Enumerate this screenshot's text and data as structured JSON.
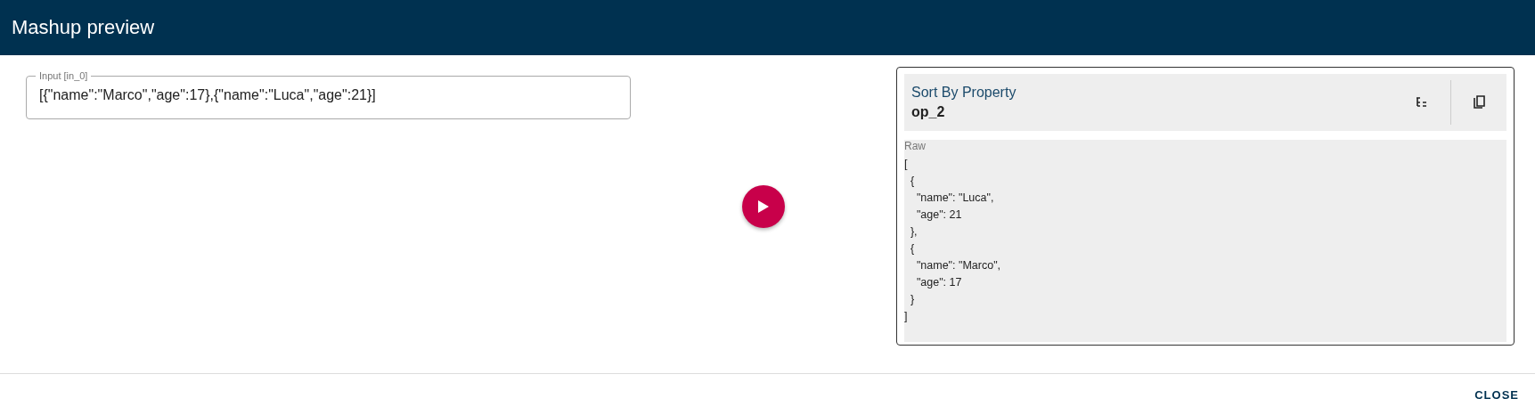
{
  "dialog": {
    "title": "Mashup preview"
  },
  "input": {
    "label": "Input [in_0]",
    "value": "[{\"name\":\"Marco\",\"age\":17},{\"name\":\"Luca\",\"age\":21}]"
  },
  "result": {
    "operator": "Sort By Property",
    "id": "op_2",
    "raw_label": "Raw",
    "raw": "[\n  {\n    \"name\": \"Luca\",\n    \"age\": 21\n  },\n  {\n    \"name\": \"Marco\",\n    \"age\": 17\n  }\n]"
  },
  "actions": [
    "CLOSE"
  ]
}
